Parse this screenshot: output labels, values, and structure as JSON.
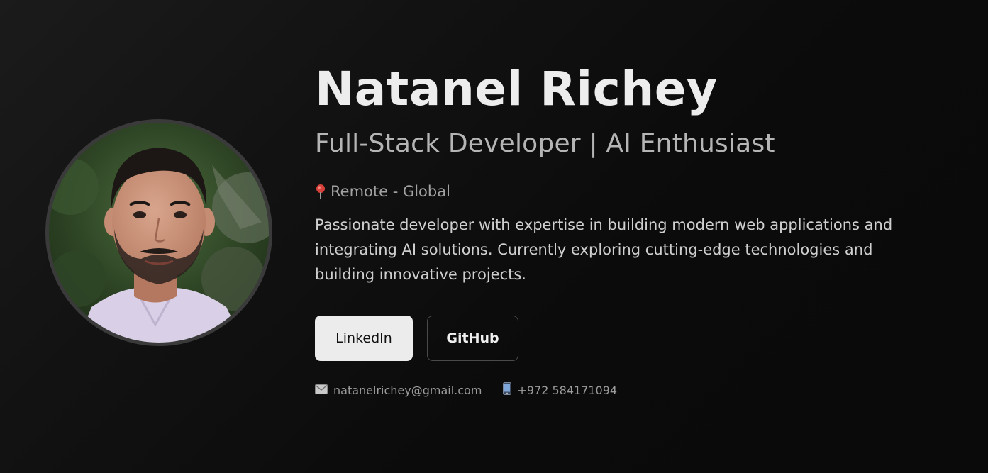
{
  "profile": {
    "name": "Natanel Richey",
    "title": "Full-Stack Developer | AI Enthusiast",
    "location": "Remote - Global",
    "bio": "Passionate developer with expertise in building modern web applications and integrating AI solutions. Currently exploring cutting-edge technologies and building innovative projects."
  },
  "buttons": {
    "linkedin": "LinkedIn",
    "github": "GitHub"
  },
  "contact": {
    "email": "natanelrichey@gmail.com",
    "phone": "+972 584171094"
  },
  "icons": {
    "location": "map-pin-icon",
    "email": "envelope-icon",
    "phone": "mobile-phone-icon"
  },
  "colors": {
    "background": "#0b0b0b",
    "name": "#ededed",
    "primary_button_bg": "#ececec",
    "pin": "#d9423a"
  }
}
